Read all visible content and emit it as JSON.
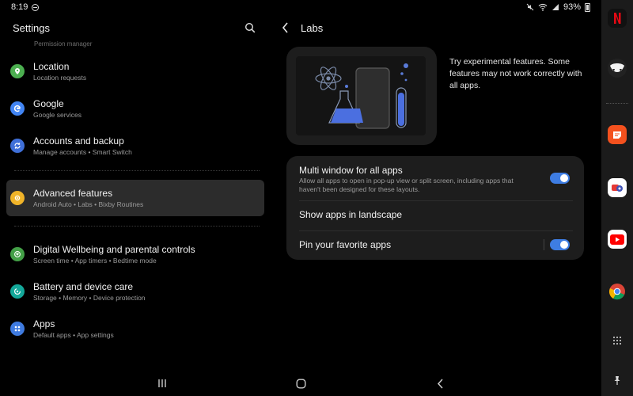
{
  "status_bar": {
    "time": "8:19",
    "battery": "93%"
  },
  "left_pane": {
    "title": "Settings",
    "faded_item": "Permission manager",
    "items": [
      {
        "title": "Location",
        "subtitle": "Location requests",
        "icon": "location-pin-icon",
        "color": "#4caf50"
      },
      {
        "title": "Google",
        "subtitle": "Google services",
        "icon": "google-icon",
        "color": "#4285f4"
      },
      {
        "title": "Accounts and backup",
        "subtitle": "Manage accounts  •  Smart Switch",
        "icon": "sync-icon",
        "color": "#3f6fd8"
      },
      {
        "title": "Advanced features",
        "subtitle": "Android Auto  •  Labs  •  Bixby Routines",
        "icon": "gear-plus-icon",
        "color": "#f0b429"
      },
      {
        "title": "Digital Wellbeing and parental controls",
        "subtitle": "Screen time  •  App timers  •  Bedtime mode",
        "icon": "heart-circle-icon",
        "color": "#43a047"
      },
      {
        "title": "Battery and device care",
        "subtitle": "Storage  •  Memory  •  Device protection",
        "icon": "device-care-icon",
        "color": "#14a89a"
      },
      {
        "title": "Apps",
        "subtitle": "Default apps  •  App settings",
        "icon": "apps-grid-icon",
        "color": "#3f7be0"
      }
    ]
  },
  "right_pane": {
    "title": "Labs",
    "intro": "Try experimental features. Some features may not work correctly with all apps.",
    "options": [
      {
        "title": "Multi window for all apps",
        "description": "Allow all apps to open in pop-up view or split screen, including apps that haven't been designed for these layouts.",
        "enabled": true
      },
      {
        "title": "Show apps in landscape"
      },
      {
        "title": "Pin your favorite apps",
        "enabled": true
      }
    ]
  },
  "taskbar": {
    "apps": [
      "netflix-icon",
      "dracula-app-icon",
      "notes-app-icon",
      "duo-app-icon",
      "youtube-icon",
      "chrome-icon",
      "app-drawer-icon",
      "pin-icon"
    ]
  },
  "colors": {
    "accent": "#3e7de3",
    "card": "#1d1d1d",
    "selected": "#2c2c2c"
  }
}
